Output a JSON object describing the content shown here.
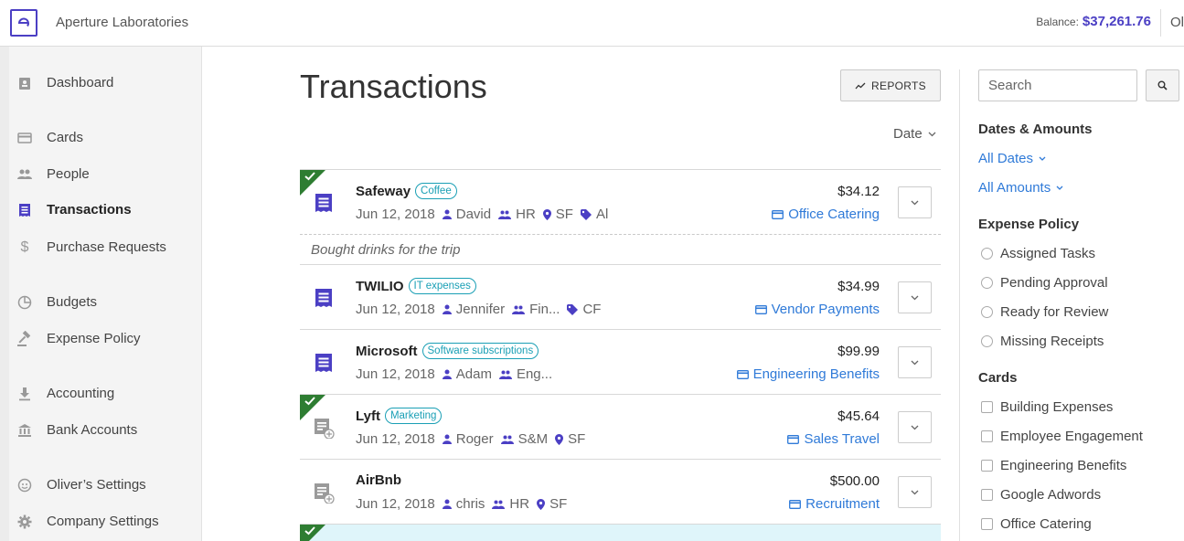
{
  "header": {
    "org_name": "Aperture Laboratories",
    "balance_label": "Balance:",
    "balance_amount": "$37,261.76",
    "user_initials_cut": "Ol"
  },
  "sidebar": {
    "items": [
      {
        "label": "Dashboard",
        "icon": "dashboard-icon"
      },
      {
        "label": "Cards",
        "icon": "card-icon"
      },
      {
        "label": "People",
        "icon": "people-icon"
      },
      {
        "label": "Transactions",
        "icon": "receipt-icon",
        "active": true
      },
      {
        "label": "Purchase Requests",
        "icon": "dollar-icon"
      },
      {
        "label": "Budgets",
        "icon": "pie-icon"
      },
      {
        "label": "Expense Policy",
        "icon": "gavel-icon"
      },
      {
        "label": "Accounting",
        "icon": "download-icon"
      },
      {
        "label": "Bank Accounts",
        "icon": "bank-icon"
      },
      {
        "label": "Oliver’s Settings",
        "icon": "face-icon"
      },
      {
        "label": "Company Settings",
        "icon": "gear-icon"
      }
    ]
  },
  "main": {
    "title": "Transactions",
    "reports_label": "REPORTS",
    "sort_label": "Date",
    "transactions": [
      {
        "merchant": "Safeway",
        "tag": "Coffee",
        "date": "Jun 12, 2018",
        "person": "David",
        "team": "HR",
        "location": "SF",
        "label": "Al",
        "amount": "$34.12",
        "budget": "Office Catering",
        "approved": true,
        "receipt": true
      },
      {
        "merchant": "TWILIO",
        "tag": "IT expenses",
        "date": "Jun 12, 2018",
        "person": "Jennifer",
        "team": "Fin...",
        "location": "",
        "label": "CF",
        "amount": "$34.99",
        "budget": "Vendor Payments",
        "approved": false,
        "receipt": true
      },
      {
        "merchant": "Microsoft",
        "tag": "Software subscriptions",
        "date": "Jun 12, 2018",
        "person": "Adam",
        "team": "Eng...",
        "location": "",
        "label": "",
        "amount": "$99.99",
        "budget": "Engineering Benefits",
        "approved": false,
        "receipt": true
      },
      {
        "merchant": "Lyft",
        "tag": "Marketing",
        "date": "Jun 12, 2018",
        "person": "Roger",
        "team": "S&M",
        "location": "SF",
        "label": "",
        "amount": "$45.64",
        "budget": "Sales Travel",
        "approved": true,
        "receipt": false
      },
      {
        "merchant": "AirBnb",
        "tag": "",
        "date": "Jun 12, 2018",
        "person": "chris",
        "team": "HR",
        "location": "SF",
        "label": "",
        "amount": "$500.00",
        "budget": "Recruitment",
        "approved": false,
        "receipt": false
      }
    ],
    "note": "Bought drinks for the trip"
  },
  "filters": {
    "search_placeholder": "Search",
    "dates_amounts_heading": "Dates & Amounts",
    "all_dates": "All Dates",
    "all_amounts": "All Amounts",
    "expense_policy_heading": "Expense Policy",
    "policy_options": [
      "Assigned Tasks",
      "Pending Approval",
      "Ready for Review",
      "Missing Receipts"
    ],
    "cards_heading": "Cards",
    "card_options": [
      "Building Expenses",
      "Employee Engagement",
      "Engineering Benefits",
      "Google Adwords",
      "Office Catering"
    ]
  },
  "colors": {
    "brand": "#4b3fc4",
    "link": "#2f7ad8",
    "tag": "#1a9fb5",
    "approved": "#2e7d32",
    "highlight": "#dff5fa"
  }
}
